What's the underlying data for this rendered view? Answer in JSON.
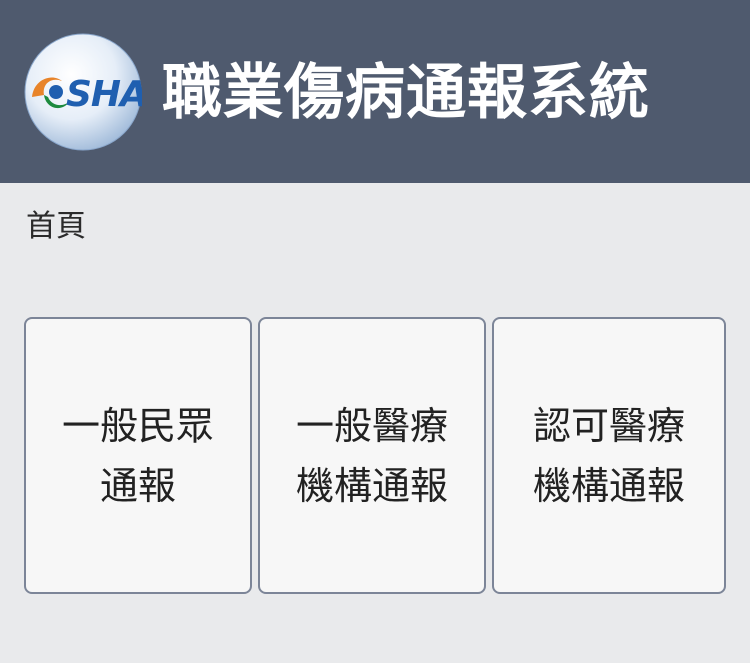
{
  "header": {
    "logo_text": "OSHA",
    "title": "職業傷病通報系統"
  },
  "breadcrumb": {
    "home": "首頁"
  },
  "cards": [
    {
      "line1": "一般民眾",
      "line2": "通報"
    },
    {
      "line1": "一般醫療",
      "line2": "機構通報"
    },
    {
      "line1": "認可醫療",
      "line2": "機構通報"
    }
  ],
  "colors": {
    "header_bg": "#4f5a6e",
    "page_bg": "#e9eaec",
    "card_bg": "#f7f7f7",
    "card_border": "#7c8598",
    "logo_blue": "#1f5fb0",
    "logo_green": "#1c8a3e",
    "logo_orange": "#e8842a"
  }
}
